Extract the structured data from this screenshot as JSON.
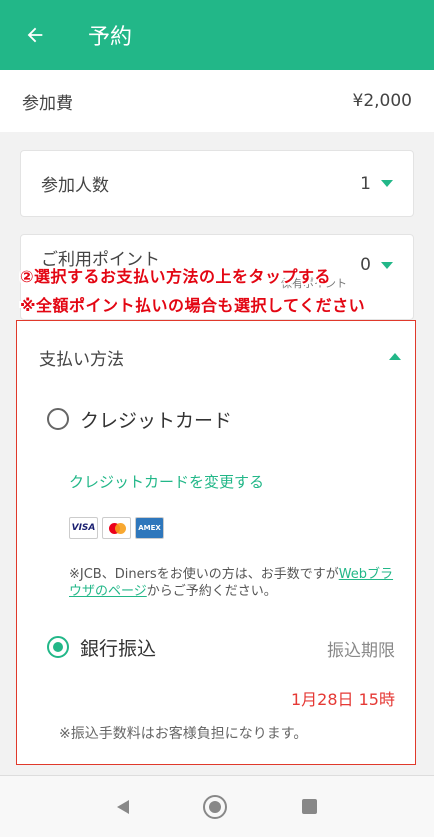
{
  "appbar": {
    "title": "予約",
    "back_icon": "arrow-left-icon"
  },
  "fee": {
    "label": "参加費",
    "value": "¥2,000"
  },
  "people": {
    "label": "参加人数",
    "value": "1"
  },
  "points": {
    "label": "ご利用ポイント",
    "sub": "保有ポイント",
    "value": "0"
  },
  "annotation": {
    "line1": "②選択するお支払い方法の上をタップする",
    "line2": "※全額ポイント払いの場合も選択してください"
  },
  "payment": {
    "header": "支払い方法",
    "credit_label": "クレジットカード",
    "change_link": "クレジットカードを変更する",
    "logos": [
      "VISA",
      "Mastercard",
      "AMERICAN EXPRESS"
    ],
    "note_prefix": "※JCB、Dinersをお使いの方は、お手数ですが",
    "note_link": "Webブラウザのページ",
    "note_suffix": "からご予約ください。",
    "bank_label": "銀行振込",
    "deadline_label": "振込期限",
    "deadline": "1月28日 15時",
    "fee_note": "※振込手数料はお客様負担になります。"
  },
  "colors": {
    "accent": "#22b788",
    "annotation": "#e30613",
    "deadline": "#e53935"
  }
}
